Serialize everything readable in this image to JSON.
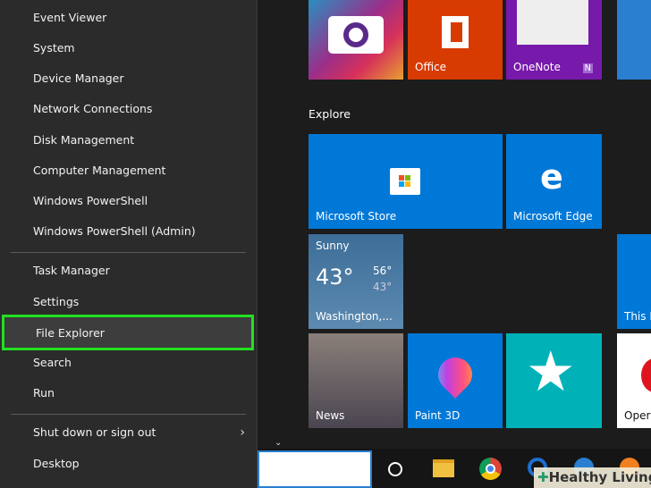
{
  "menu": {
    "items": [
      "Event Viewer",
      "System",
      "Device Manager",
      "Network Connections",
      "Disk Management",
      "Computer Management",
      "Windows PowerShell",
      "Windows PowerShell (Admin)",
      "Task Manager",
      "Settings",
      "File Explorer",
      "Search",
      "Run",
      "Shut down or sign out",
      "Desktop"
    ],
    "highlight_color": "#22e022"
  },
  "tiles": {
    "office": "Office",
    "onenote": "OneNote",
    "group": "Explore",
    "store": "Microsoft Store",
    "edge": "Microsoft Edge",
    "weather": {
      "condition": "Sunny",
      "temp": "43°",
      "high": "56°",
      "low": "43°",
      "city": "Washington,..."
    },
    "thispc": "This P",
    "news": "News",
    "paint": "Paint 3D",
    "opera": "Opera"
  },
  "watermark": "Healthy Living"
}
